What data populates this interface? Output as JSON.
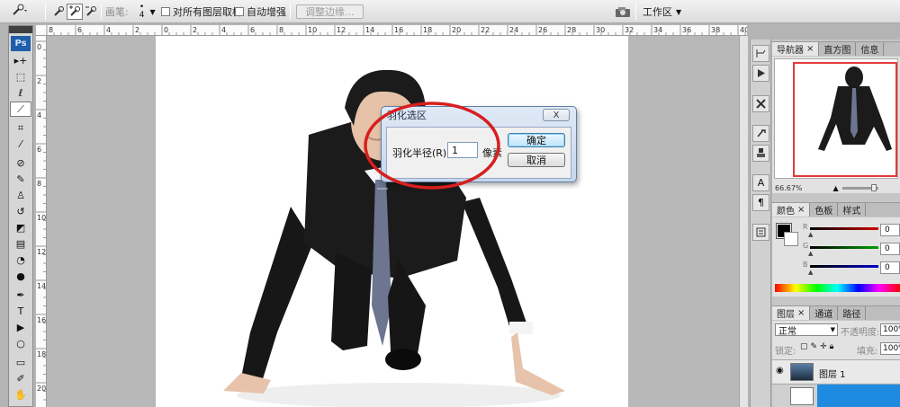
{
  "options_bar": {
    "brush_label": "画笔:",
    "brush_size": "4",
    "sample_all_layers_label": "对所有图层取样",
    "auto_enhance_label": "自动增强",
    "refine_edge_label": "调整边缘...",
    "workspace_label": "工作区"
  },
  "toolbox": {
    "logo": "Ps",
    "tools": [
      "move-tool-icon",
      "marquee-tool-icon",
      "lasso-tool-icon",
      "quick-selection-tool-icon",
      "crop-tool-icon",
      "eyedropper-tool-icon",
      "healing-brush-tool-icon",
      "brush-tool-icon",
      "clone-stamp-tool-icon",
      "history-brush-tool-icon",
      "eraser-tool-icon",
      "gradient-tool-icon",
      "blur-tool-icon",
      "dodge-tool-icon",
      "pen-tool-icon",
      "type-tool-icon",
      "path-selection-tool-icon",
      "ellipse-tool-icon",
      "notes-tool-icon",
      "eyedropper-2-tool-icon",
      "hand-tool-icon",
      "zoom-tool-icon"
    ]
  },
  "ruler": {
    "top_labels": [
      "8",
      "6",
      "4",
      "2",
      "0",
      "2",
      "4",
      "6",
      "8",
      "10",
      "12",
      "14",
      "16",
      "18",
      "20",
      "22",
      "24",
      "26",
      "28",
      "30",
      "32",
      "34",
      "36",
      "38",
      "40"
    ],
    "left_labels": [
      "0",
      "2",
      "4",
      "6",
      "8",
      "10",
      "12",
      "14",
      "16",
      "18",
      "20"
    ]
  },
  "dialog": {
    "title": "羽化选区",
    "feather_radius_label": "羽化半径(R):",
    "feather_radius_value": "1",
    "unit": "像素",
    "ok_label": "确定",
    "cancel_label": "取消",
    "close_label": "X"
  },
  "navigator_panel": {
    "tabs": [
      "导航器",
      "直方图",
      "信息"
    ],
    "zoom": "66.67%"
  },
  "color_panel": {
    "tabs": [
      "颜色",
      "色板",
      "样式"
    ],
    "channels": [
      {
        "name": "R",
        "value": "0",
        "color": "#cc0000"
      },
      {
        "name": "G",
        "value": "0",
        "color": "#00a000"
      },
      {
        "name": "B",
        "value": "0",
        "color": "#0000cc"
      }
    ]
  },
  "layers_panel": {
    "tabs": [
      "图层",
      "通道",
      "路径"
    ],
    "blend_mode": "正常",
    "opacity_label": "不透明度:",
    "opacity_value": "100%",
    "lock_label": "锁定:",
    "fill_label": "填充:",
    "fill_value": "100%",
    "layers": [
      "图层 1"
    ]
  }
}
